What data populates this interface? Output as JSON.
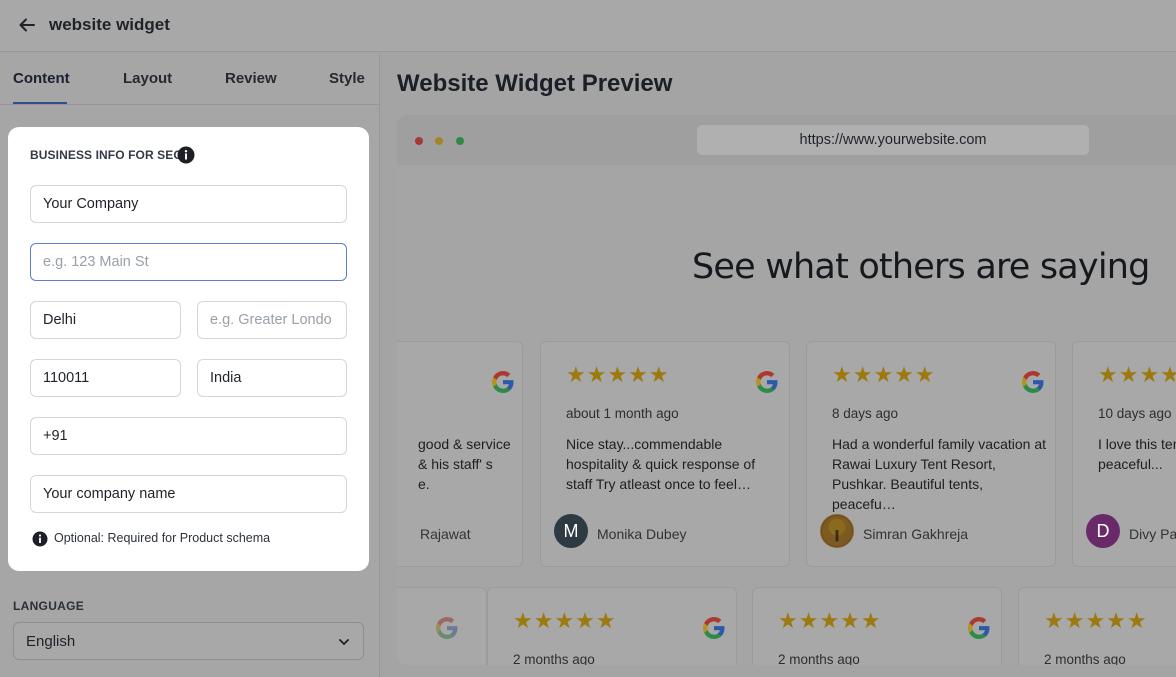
{
  "header": {
    "title": "website widget"
  },
  "tabs": [
    {
      "label": "Content"
    },
    {
      "label": "Layout"
    },
    {
      "label": "Review"
    },
    {
      "label": "Style"
    }
  ],
  "seo_card": {
    "heading": "BUSINESS INFO FOR SEO",
    "company": {
      "value": "Your Company"
    },
    "street": {
      "placeholder": "e.g. 123 Main St"
    },
    "city": {
      "value": "Delhi"
    },
    "region": {
      "placeholder": "e.g. Greater Londo"
    },
    "postal": {
      "value": "110011"
    },
    "country": {
      "value": "India"
    },
    "phone": {
      "value": "+91"
    },
    "brand": {
      "value": "Your company name"
    },
    "note": "Optional: Required for Product schema"
  },
  "language": {
    "label": "LANGUAGE",
    "value": "English"
  },
  "preview": {
    "title": "Website Widget Preview",
    "url": "https://www.yourwebsite.com",
    "headline": "See what others are saying"
  },
  "reviews": [
    {
      "date": "",
      "text": "good & service\n& his staff' s\ne.",
      "name": "Rajawat",
      "stars": "★★★★★"
    },
    {
      "date": "about 1 month ago",
      "text": "Nice stay...commendable hospitality & quick response of staff Try atleast once to feel…",
      "name": "Monika Dubey",
      "initial": "M",
      "stars": "★★★★★"
    },
    {
      "date": "8 days ago",
      "text": "Had a wonderful family vacation at Rawai Luxury Tent Resort, Pushkar. Beautiful tents, peacefu…",
      "name": "Simran Gakhreja",
      "stars": "★★★★★"
    },
    {
      "date": "10 days ago",
      "text": "I love this ten peaceful...",
      "name": "Divy Pa",
      "initial": "D",
      "stars": "★★★★★"
    }
  ],
  "reviews_row2": [
    {
      "date": "2 months ago",
      "stars": "★★★★★"
    },
    {
      "date": "2 months ago",
      "stars": "★★★★★"
    },
    {
      "date": "2 months ago",
      "stars": "★★★★★"
    }
  ],
  "colors": {
    "accent": "#2d4f92",
    "star": "#9c7a10",
    "overlay": "#a6a6a6"
  }
}
